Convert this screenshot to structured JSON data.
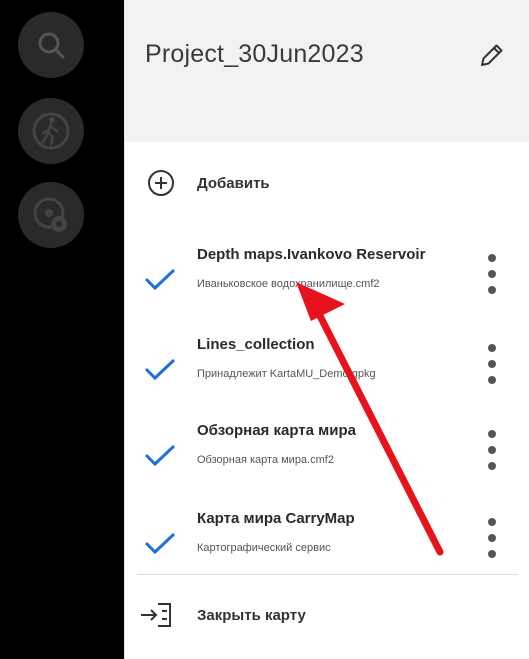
{
  "rail": {
    "buttons": [
      {
        "icon": "search-icon"
      },
      {
        "icon": "walker-location-icon"
      },
      {
        "icon": "location-settings-icon"
      }
    ]
  },
  "header": {
    "title": "Project_30Jun2023",
    "edit_icon": "pencil-icon"
  },
  "add": {
    "label": "Добавить",
    "icon": "plus-circle-icon"
  },
  "layers": [
    {
      "title": "Depth maps.Ivankovo Reservoir",
      "subtitle": "Иваньковское водохранилище.cmf2",
      "checked": true
    },
    {
      "title": "Lines_collection",
      "subtitle": "Принадлежит KartaMU_Demo.gpkg",
      "checked": true
    },
    {
      "title": "Обзорная карта мира",
      "subtitle": "Обзорная карта мира.cmf2",
      "checked": true
    },
    {
      "title": "Карта мира CarryMap",
      "subtitle": "Картографический сервис",
      "checked": true
    }
  ],
  "close": {
    "label": "Закрыть карту",
    "icon": "exit-map-icon"
  },
  "colors": {
    "accent": "#1e6fd6",
    "annotation_arrow": "#e8121c",
    "header_bg": "#f2f2f2"
  }
}
